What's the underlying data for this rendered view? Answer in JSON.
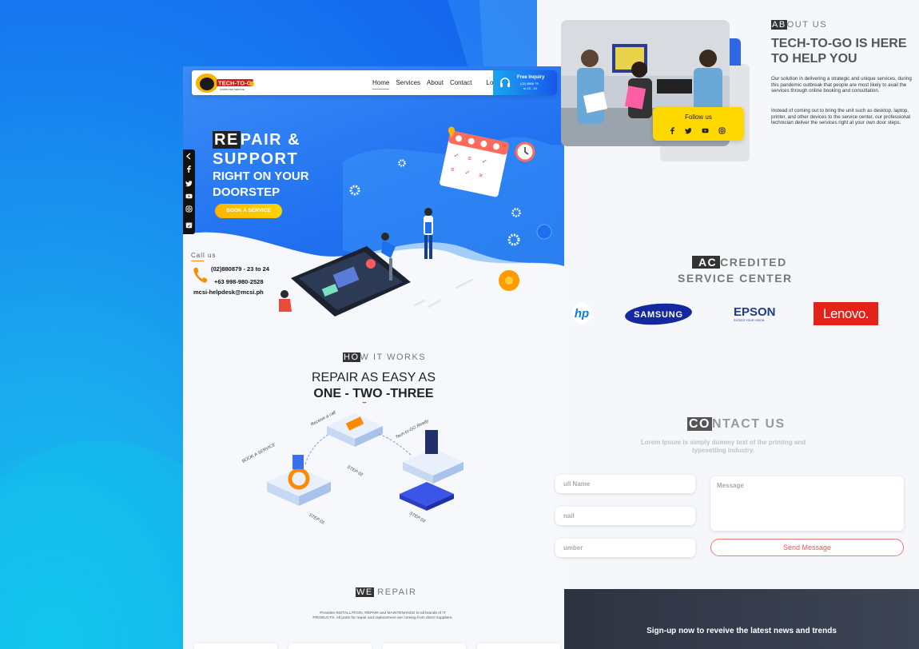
{
  "nav": {
    "logo_alt": "TECH-TO-GO",
    "links": [
      "Home",
      "Services",
      "About",
      "Contact"
    ],
    "login": "Login",
    "inquiry_title": "Free Inquiry",
    "inquiry_phone": "(02) 8808 79",
    "inquiry_hours": "to 23 - 24"
  },
  "hero": {
    "title_hl": "RE",
    "title_rest": "PAIR &",
    "title_line2": "SUPPORT",
    "title_line3": "RIGHT ON YOUR",
    "title_line4": "DOORSTEP",
    "cta": "BOOK A SERVICE"
  },
  "call": {
    "label": "Call us",
    "phone1": "(02)880879 - 23 to 24",
    "phone2": "+63 998-980-2528",
    "email": "mcsi-helpdesk@mcsi.ph"
  },
  "how": {
    "tag_hl": "HO",
    "tag_rest": "W IT WORKS",
    "title_line1": "REPAIR AS EASY AS",
    "title_line2": "ONE - TWO -THREE",
    "steps": [
      "BOOK A SERVICE",
      "Receive a call",
      "Tech-to-GO Ready",
      "STEP 01",
      "STEP 02",
      "STEP 03"
    ]
  },
  "we_repair": {
    "tag_hl": "WE",
    "tag_rest": " REPAIR",
    "desc": "Provides INSTALLATION, REPAIR and MAINTENANCE to all brands of IT PRODUCTS. All parts for repair and replacement are coming from direct suppliers."
  },
  "about": {
    "tag_hl": "AB",
    "tag_rest": "OUT US",
    "title": "TECH-TO-GO IS HERE TO HELP YOU",
    "p1": "Our solution in delivering a strategic and unique services, during this pandemic outbreak that people are most likely to avail the services through online booking and consultation.",
    "p2": "Instead of coming out to bring the unit such as desktop, laptop, printer, and other devices to the service center, our professional technician deliver the services right at your own door steps.",
    "follow_label": "Follow us"
  },
  "accredited": {
    "tag_hl": "AC",
    "tag_rest": "CREDITED",
    "line2": "SERVICE CENTER",
    "brands": [
      "hp",
      "SAMSUNG",
      "EPSON",
      "EXCEED YOUR VISION",
      "Lenovo."
    ]
  },
  "contact": {
    "tag_hl": "CO",
    "tag_rest": "NTACT US",
    "sub": "Lorem Ipsum is simply dummy text of the printing and typesetting industry.",
    "name_placeholder": "ull Name",
    "email_placeholder": "nail",
    "number_placeholder": "umber",
    "message_placeholder": "Message",
    "send": "Send Message"
  },
  "footer": {
    "signup": "Sign-up now to reveive the latest news and trends"
  },
  "colors": {
    "brand_blue": "#1f6ff0",
    "accent_yellow": "#ffd400",
    "accent_orange": "#ff8a00",
    "lenovo_red": "#e2231a"
  },
  "icons": [
    "facebook-icon",
    "twitter-icon",
    "youtube-icon",
    "instagram-icon",
    "calendar-icon",
    "headphones-icon",
    "phone-icon",
    "chevron-left-icon"
  ]
}
